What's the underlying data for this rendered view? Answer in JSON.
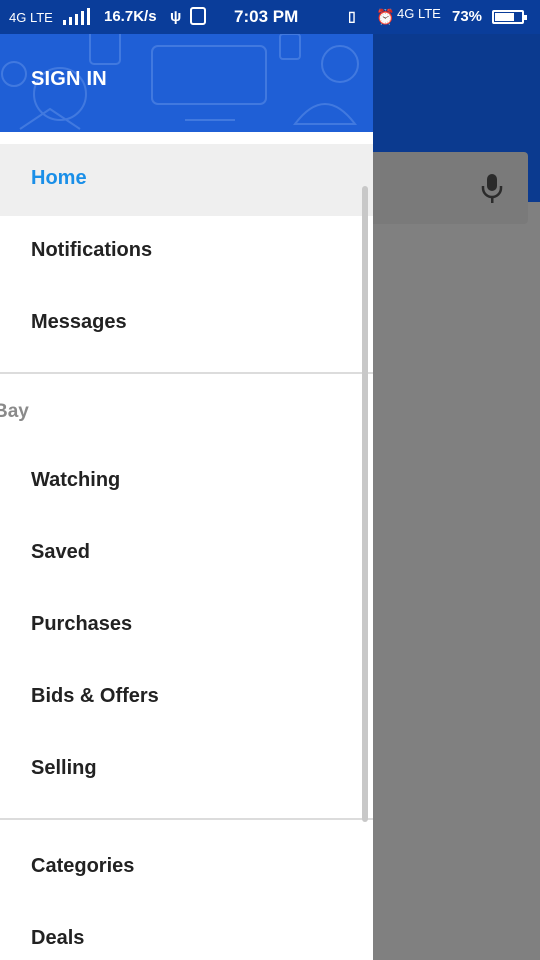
{
  "status_bar": {
    "network_left": "4G LTE",
    "speed": "16.7K/s",
    "time": "7:03 PM",
    "network_right": "4G LTE",
    "battery": "73%",
    "battery_level": 0.73
  },
  "drawer": {
    "sign_in": "SIGN IN",
    "primary_items": [
      "Home",
      "Notifications",
      "Messages"
    ],
    "section_title": "Bay",
    "my_items": [
      "Watching",
      "Saved",
      "Purchases",
      "Bids & Offers",
      "Selling"
    ],
    "more_items": [
      "Categories",
      "Deals"
    ]
  },
  "colors": {
    "drawer_header": "#1f5fd6",
    "active_text": "#1a8fe8",
    "app_header": "#0b3a8f"
  }
}
